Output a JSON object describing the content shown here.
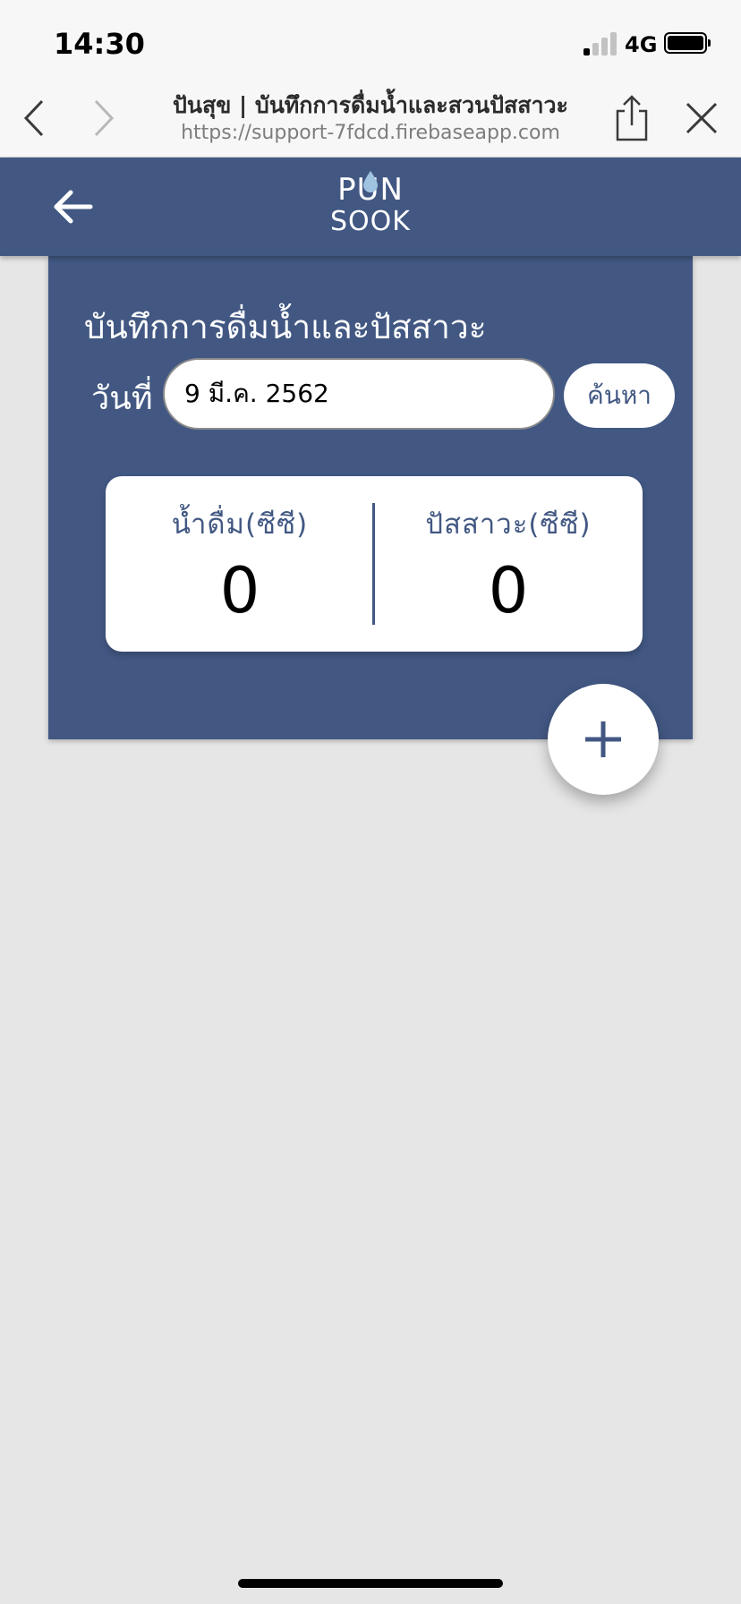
{
  "status_bar": {
    "time": "14:30",
    "network": "4G",
    "icons": [
      "signal-icon",
      "battery-icon"
    ]
  },
  "browser": {
    "title": "ปันสุข | บันทึกการดื่มน้ำและสวนปัสสาวะ",
    "url": "https://support-7fdcd.firebaseapp.com",
    "icons": [
      "chevron-left-icon",
      "chevron-right-icon",
      "share-icon",
      "close-icon"
    ]
  },
  "header": {
    "logo_line1": "PUN",
    "logo_line2": "SOOK",
    "icons": [
      "arrow-left-icon",
      "water-drop-icon"
    ],
    "color": "#425883"
  },
  "card": {
    "title": "บันทึกการดื่มน้ำและปัสสาวะ",
    "date_label": "วันที่",
    "date_value": "9 มี.ค. 2562",
    "search_label": "ค้นหา"
  },
  "summary": {
    "water_label": "น้ำดื่ม(ซีซี)",
    "water_value": "0",
    "urine_label": "ปัสสาวะ(ซีซี)",
    "urine_value": "0"
  },
  "fab": {
    "icon": "plus-icon"
  }
}
